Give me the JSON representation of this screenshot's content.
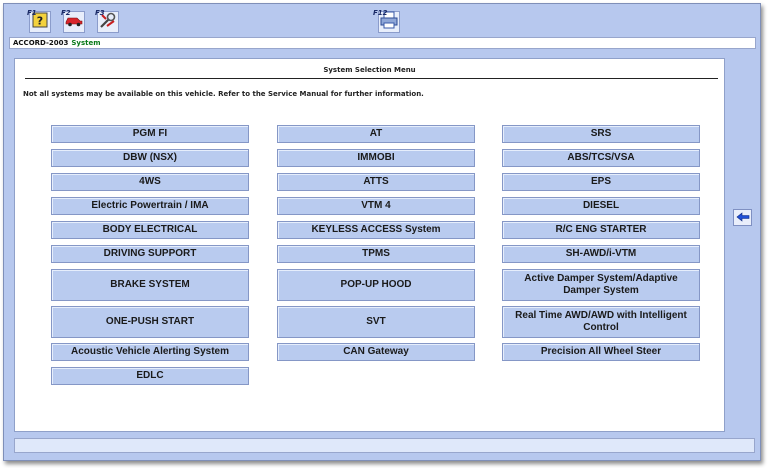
{
  "toolbar": {
    "f1": {
      "key": "F1",
      "icon": "help-icon"
    },
    "f2": {
      "key": "F2",
      "icon": "vehicle-icon"
    },
    "f3": {
      "key": "F3",
      "icon": "settings-icon"
    },
    "f12": {
      "key": "F12",
      "icon": "print-icon"
    }
  },
  "vehicle_bar": {
    "vehicle": "ACCORD-2003",
    "system": "System"
  },
  "main": {
    "title": "System Selection Menu",
    "notice": "Not all systems may be available on this vehicle. Refer to the Service Manual for further information."
  },
  "systems": {
    "col1": [
      "PGM FI",
      "DBW (NSX)",
      "4WS",
      "Electric Powertrain / IMA",
      "BODY ELECTRICAL",
      "DRIVING SUPPORT",
      "BRAKE SYSTEM",
      "ONE-PUSH START",
      "Acoustic Vehicle Alerting System",
      "EDLC"
    ],
    "col2": [
      "AT",
      "IMMOBI",
      "ATTS",
      "VTM 4",
      "KEYLESS ACCESS System",
      "TPMS",
      "POP-UP HOOD",
      "SVT",
      "CAN Gateway"
    ],
    "col3": [
      "SRS",
      "ABS/TCS/VSA",
      "EPS",
      "DIESEL",
      "R/C ENG STARTER",
      "SH-AWD/i-VTM",
      "Active Damper System/Adaptive Damper System",
      "Real Time AWD/AWD with Intelligent Control",
      "Precision All Wheel Steer"
    ]
  },
  "side": {
    "back_icon": "back-arrow-icon"
  },
  "colors": {
    "frame": "#b7c8ee",
    "button": "#b9cbef",
    "accent_green": "#0a7a1a",
    "arrow_blue": "#1f4fd6"
  }
}
